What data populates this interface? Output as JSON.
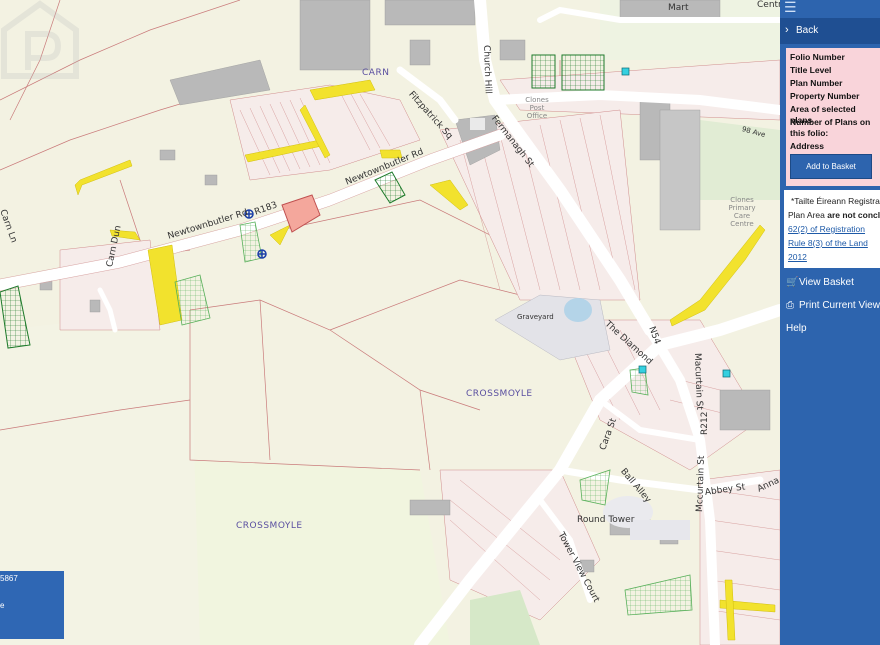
{
  "map": {
    "road_labels": {
      "church_hill": "Church Hill",
      "fitzpatrick_sq": "Fitzpatrick Sq",
      "fermanagh_st": "Fermanagh St",
      "newtownbutler_rd_1": "Newtownbutler Rd",
      "newtownbutler_rd_2": "Newtownbutler Rd",
      "r183": "R183",
      "carn_dun": "Carn Dun",
      "carn_ln": "Carn Ln",
      "the_diamond": "The Diamond",
      "n54": "N54",
      "macurtain_st_1": "Macurtain St",
      "macurtain_st_2": "Mccurtain St",
      "r212": "R212",
      "cara_st": "Cara St",
      "ball_alley": "Ball Alley",
      "abbey_st": "Abbey St",
      "tower_view_court": "Tower View Court",
      "annalore": "Anna",
      "mart": "Mart",
      "centre": "Centre",
      "dr_ave": "98 Ave"
    },
    "places": {
      "carn": "CARN",
      "crossmoyle_1": "CROSSMOYLE",
      "crossmoyle_2": "CROSSMOYLE",
      "graveyard": "Graveyard",
      "round_tower": "Round Tower",
      "post_office": "Clones Post Office",
      "primary_care": "Clones Primary Care Centre"
    },
    "coord_box": {
      "line1": "5867",
      "line2": "e"
    }
  },
  "sidebar": {
    "back_label": "Back",
    "fields": {
      "folio_number": "Folio Number",
      "title_level": "Title Level",
      "plan_number": "Plan Number",
      "property_number": "Property Number",
      "area_selected": "Area of selected plans",
      "num_plans_1": "Number of Plans on",
      "num_plans_2": "this folio:",
      "address": "Address"
    },
    "add_to_basket": "Add to Basket",
    "note": {
      "line1": "*Tailte Éireann Registra",
      "line2a": "Plan Area ",
      "line2b": "are not concl",
      "line3": "62(2) of Registration",
      "line4": "Rule 8(3) of the Land",
      "line5": "2012"
    },
    "menu": {
      "view_basket": "View Basket",
      "print_view": "Print Current View",
      "help": "Help"
    }
  },
  "colors": {
    "sidebar_bg": "#2d64ae",
    "parcel_red": "#e08484",
    "plan_yellow": "#f2e22d",
    "plan_green": "#1d7a2a",
    "selected_parcel": "#f4a79c"
  }
}
